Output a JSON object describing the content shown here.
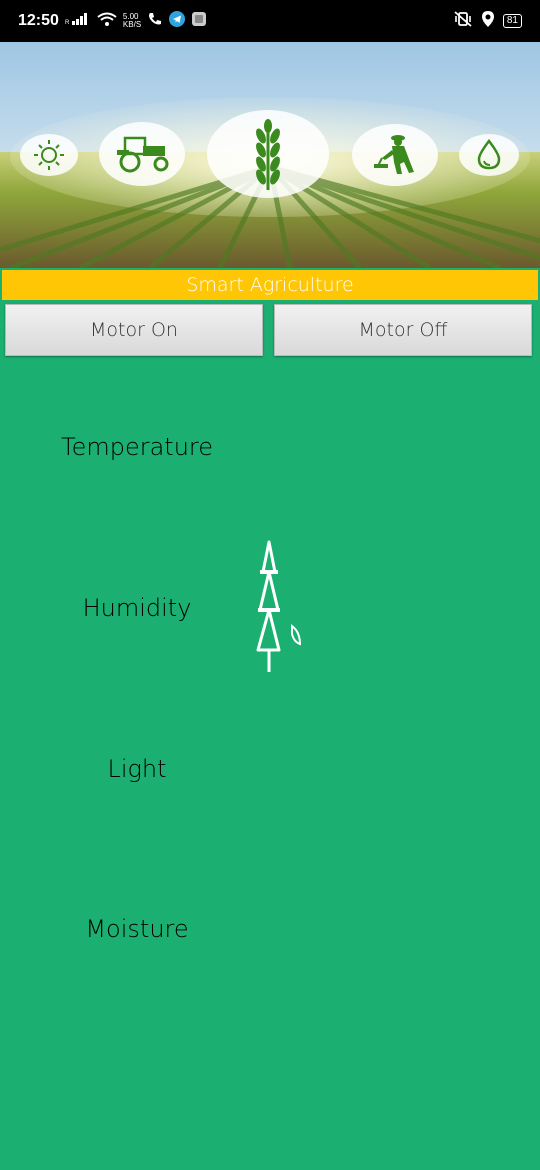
{
  "status_bar": {
    "time": "12:50",
    "net_speed": "5.00",
    "net_unit": "KB/S",
    "battery": "81"
  },
  "header": {
    "icons": [
      "sun-icon",
      "tractor-icon",
      "wheat-icon",
      "farmer-icon",
      "water-drop-icon"
    ]
  },
  "app": {
    "title": "Smart Agriculture",
    "motor_on_label": "Motor On",
    "motor_off_label": "Motor Off"
  },
  "sensors": {
    "temperature_label": "Temperature",
    "humidity_label": "Humidity",
    "light_label": "Light",
    "moisture_label": "Moisture"
  },
  "colors": {
    "background": "#1bb071",
    "title_bar": "#fec604",
    "icon_green": "#3a8a1e"
  }
}
